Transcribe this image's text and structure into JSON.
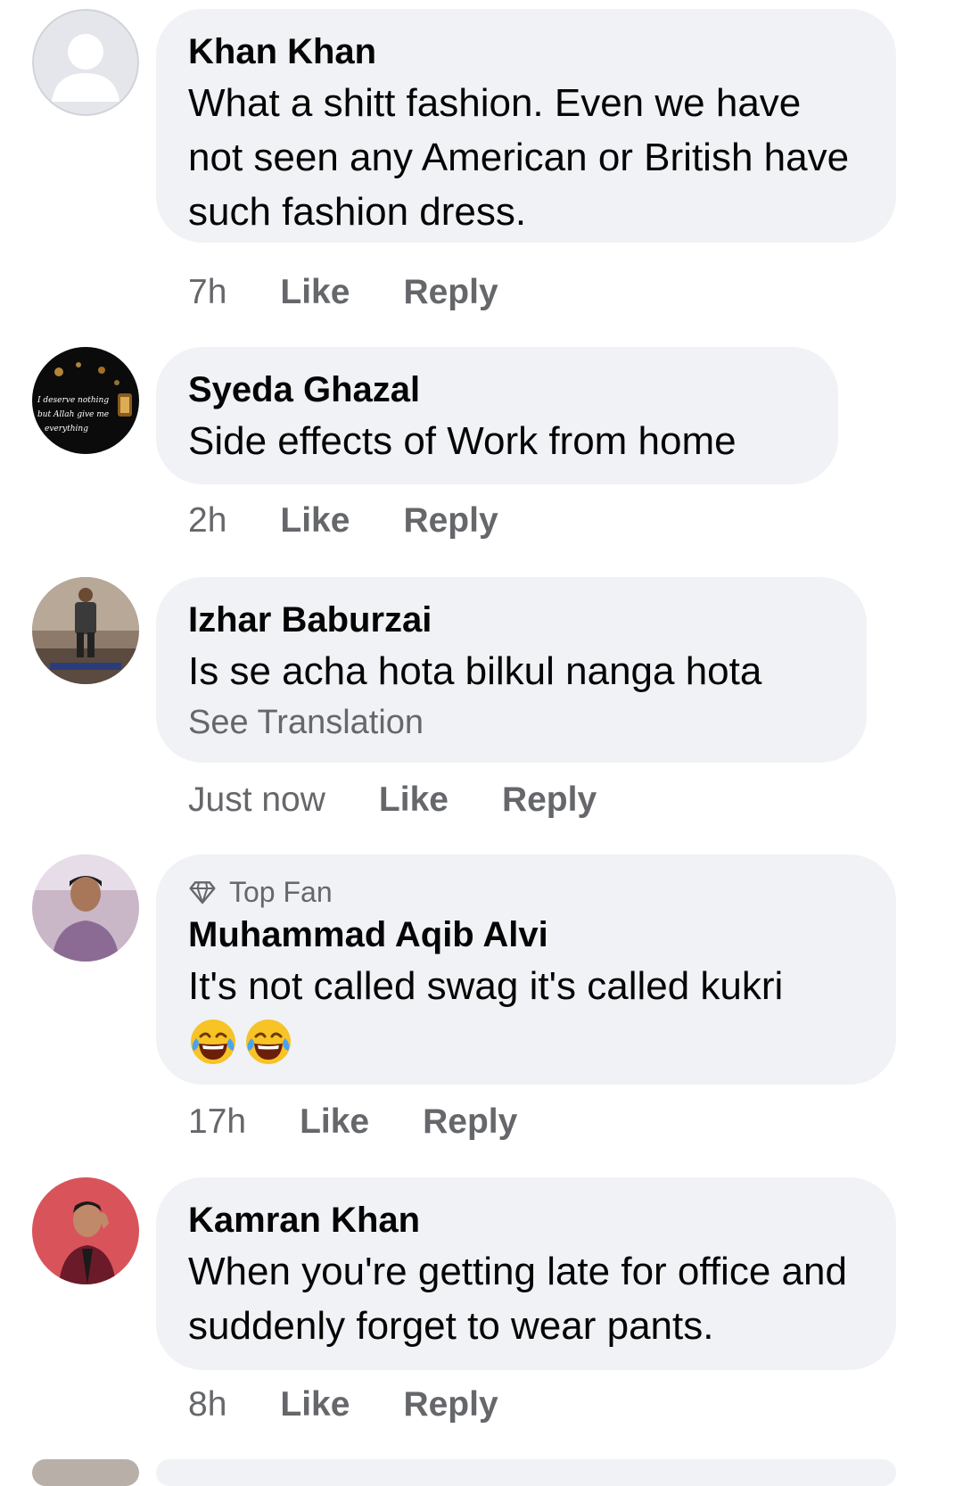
{
  "comments": [
    {
      "author": "Khan Khan",
      "text": "What a shitt fashion. Even we have not seen any American or British have such fashion dress.",
      "time": "7h",
      "like_label": "Like",
      "reply_label": "Reply",
      "avatar": "default-silhouette"
    },
    {
      "author": "Syeda Ghazal",
      "text": "Side effects of Work from home",
      "time": "2h",
      "like_label": "Like",
      "reply_label": "Reply",
      "avatar": "lantern-quote",
      "avatar_caption": "I deserve nothing but Allah give me everything"
    },
    {
      "author": "Izhar Baburzai",
      "text": "Is se acha hota bilkul nanga hota",
      "see_translation": "See Translation",
      "time": "Just now",
      "like_label": "Like",
      "reply_label": "Reply",
      "avatar": "man-standing-photo"
    },
    {
      "badge_label": "Top Fan",
      "badge_icon": "diamond-icon",
      "author": "Muhammad Aqib Alvi",
      "text": "It's not called swag it's called kukri",
      "emojis": [
        "tears-of-joy-emoji",
        "tears-of-joy-emoji"
      ],
      "time": "17h",
      "like_label": "Like",
      "reply_label": "Reply",
      "avatar": "young-man-photo"
    },
    {
      "author": "Kamran Khan",
      "text": "When you're getting late for office and suddenly forget to wear pants.",
      "time": "8h",
      "like_label": "Like",
      "reply_label": "Reply",
      "avatar": "man-pink-background-photo"
    }
  ],
  "colors": {
    "bubble": "#f0f2f5",
    "text": "#050505",
    "meta": "#65676b"
  }
}
